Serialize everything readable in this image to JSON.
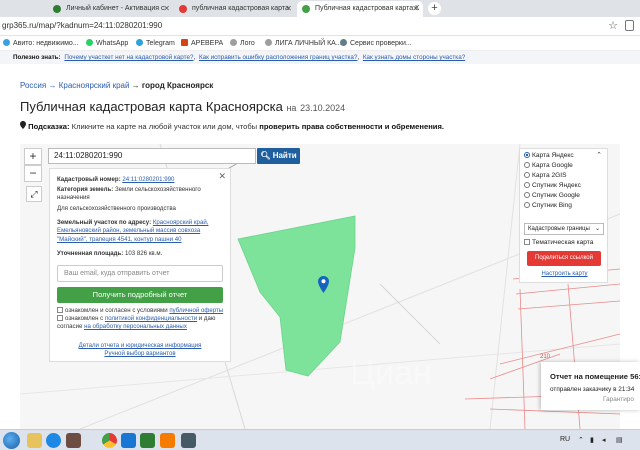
{
  "browser": {
    "tabs": [
      {
        "title": "Личный кабинет - Активация с",
        "active": false,
        "icon_color": "#2e7d32"
      },
      {
        "title": "публичная кадастровая карта",
        "active": false,
        "icon_color": "#e53935"
      },
      {
        "title": "Публичная кадастровая карта К",
        "active": true,
        "icon_color": "#43a047"
      }
    ],
    "url": "grp365.ru/map/?kadnum=24:11:0280201:990",
    "bookmarks": [
      "Авито: недвижимо...",
      "WhatsApp",
      "Telegram",
      "АРЕВЕРА",
      "Лого",
      "ЛИГА ЛИЧНЫЙ КА...",
      "Сервис проверки..."
    ]
  },
  "helpbar": {
    "label": "Полезно знать:",
    "links": [
      "Почему участкет нет на кадастровой карте?",
      "Как исправить ошибку расположения границ участка?",
      "Как узнать домы стороны участка?"
    ]
  },
  "breadcrumb": {
    "items": [
      "Россия",
      "Красноярский край"
    ],
    "current": "город Красноярск",
    "sep": "→"
  },
  "title": {
    "main": "Публичная кадастровая карта Красноярска",
    "date_prefix": "на",
    "date": "23.10.2024"
  },
  "hint": {
    "label": "Подсказка:",
    "text": "Кликните на карте на любой участок или дом, чтобы",
    "bold": "проверить права собственности и обременения."
  },
  "search": {
    "value": "24:11:0280201:990",
    "button": "Найти"
  },
  "zoom": {
    "in": "+",
    "out": "−"
  },
  "panel": {
    "kadnum_label": "Кадастровый номер:",
    "kadnum_value": "24:11:0280201:990",
    "category_label": "Категория земель:",
    "category_value": "Земли сельскохозяйственного назначения",
    "usage": "Для сельскохозяйственного производства",
    "address_label": "Земельный участок по адресу:",
    "address_value": "Красноярский край, Емельяновский район, земельный массив совхоза \"Майский\", трапеция 4541, контур пашни 40",
    "area_label": "Уточненная площадь:",
    "area_value": "103 826 кв.м.",
    "email_placeholder": "Ваш email, куда отправить отчет",
    "get_button": "Получить подробный отчет",
    "agree1_pre": "ознакомлен и согласен с условиями",
    "agree1_link": "публичной оферты",
    "agree2_pre": "ознакомлен с",
    "agree2_link1": "политикой конфиденциальности",
    "agree2_mid": "и даю согласие",
    "agree2_link2": "на обработку персональных данных",
    "details_link": "Детали отчета и юридическая информация",
    "manual_link": "Ручной выбор вариантов"
  },
  "layers": {
    "options": [
      "Карта Яндекс",
      "Карта Google",
      "Карта 2GIS",
      "Спутник Яндекс",
      "Спутник Google",
      "Спутник Bing"
    ],
    "selected_index": 0,
    "select_value": "Кадастровые границы",
    "thematic": "Тематическая карта",
    "share": "Поделиться ссылкой",
    "setup": "Настроить карту"
  },
  "map": {
    "plot_color": "#7de39a",
    "road_color": "#e98a8a",
    "label_210": "210"
  },
  "notification": {
    "title": "Отчет на помещение 56:3",
    "subtitle": "отправлен заказчику в 21:34",
    "guarantee": "Гарантиро"
  },
  "taskbar": {
    "lang": "RU"
  }
}
